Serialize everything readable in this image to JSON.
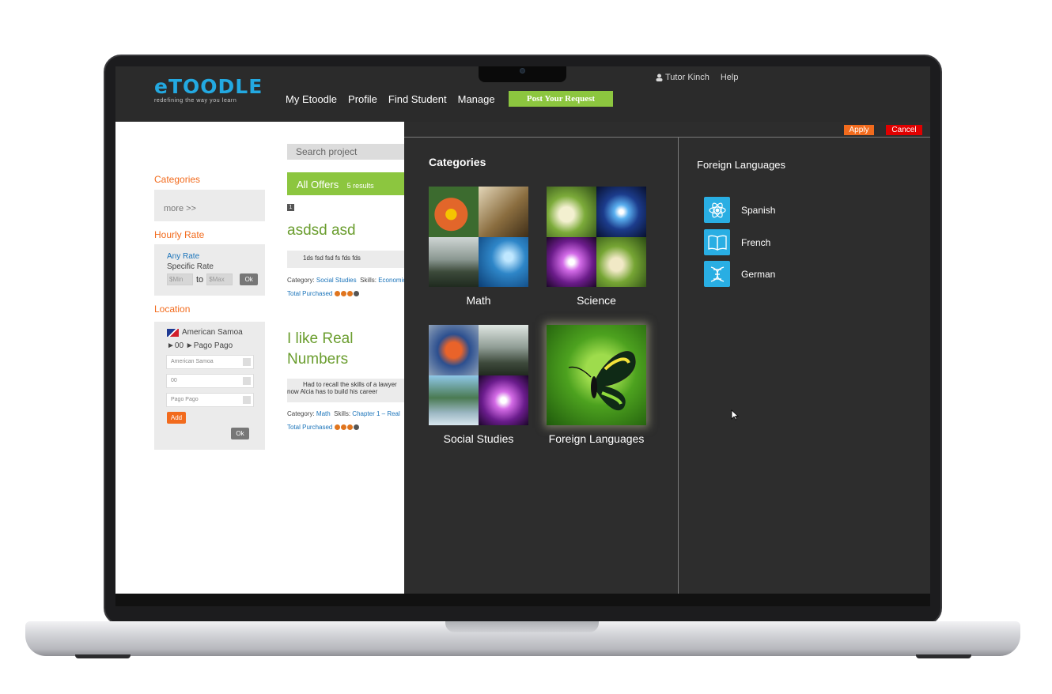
{
  "app": {
    "logo_word": "eTOODLE",
    "logo_tagline": "redefining the way you learn"
  },
  "user_menu": {
    "user_name": "Tutor Kinch",
    "help": "Help"
  },
  "nav": {
    "items": [
      "My Etoodle",
      "Profile",
      "Find Student",
      "Manage"
    ],
    "cta": "Post Your Request"
  },
  "filters": {
    "categories": {
      "title": "Categories",
      "more": "more >>"
    },
    "hourly_rate": {
      "title": "Hourly Rate",
      "any": "Any Rate",
      "specific": "Specific Rate",
      "min_placeholder": "$Min",
      "to": "to",
      "max_placeholder": "$Max",
      "ok": "Ok"
    },
    "location": {
      "title": "Location",
      "country": "American Samoa",
      "breadcrumb": "►00 ►Pago Pago",
      "select_country": "American Samoa",
      "select_state": "00",
      "select_city": "Pago Pago",
      "add": "Add",
      "ok": "Ok"
    }
  },
  "results": {
    "search_placeholder": "Search project",
    "offers_label": "All Offers",
    "offers_count": "5 results",
    "page": "1",
    "items": [
      {
        "title": "asdsd asd",
        "desc": "1ds fsd fsd fs fds fds",
        "category_label": "Category:",
        "category": "Social Studies",
        "skills_label": "Skills:",
        "skills": "Economics",
        "total": "Total Purchased"
      },
      {
        "title": "I like Real Numbers",
        "desc_line1": "Had to recall the skills of a lawyer",
        "desc_line2": "now Alcia has to build his career",
        "category_label": "Category:",
        "category": "Math",
        "skills_label": "Skills:",
        "skills": "Chapter 1 – Real",
        "total": "Total Purchased"
      }
    ]
  },
  "overlay": {
    "apply": "Apply",
    "cancel": "Cancel",
    "heading": "Categories",
    "categories": [
      "Math",
      "Science",
      "Social Studies",
      "Foreign Languages"
    ],
    "selected_category": "Foreign Languages",
    "subcategories": [
      "Spanish",
      "French",
      "German"
    ]
  },
  "icons": {
    "user": "user-icon",
    "spanish": "atom-icon",
    "french": "book-icon",
    "german": "dna-icon",
    "cursor": "mouse-cursor-icon"
  },
  "colors": {
    "brand_blue": "#23a9e1",
    "accent_green": "#8cc63f",
    "accent_orange": "#f26b1d",
    "cancel_red": "#e00000",
    "overlay_bg": "#2d2d2d",
    "link_blue": "#1b74ba"
  }
}
